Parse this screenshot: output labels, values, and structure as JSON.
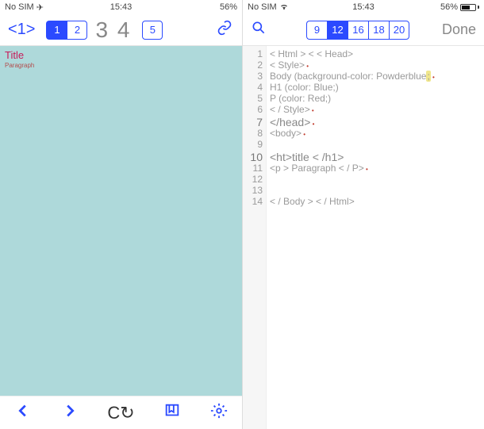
{
  "status": {
    "carrier": "No SIM",
    "time": "15:43",
    "battery_pct": "56%"
  },
  "left": {
    "toolbar": {
      "tag_label": "<1>",
      "seg": [
        "1",
        "2"
      ],
      "seg_active": 0,
      "big_digits": "3 4",
      "seg2": [
        "5"
      ]
    },
    "preview": {
      "title": "Title",
      "subtitle": "Paragraph"
    },
    "bottom_icons": [
      "back",
      "forward",
      "refresh",
      "bookmarks",
      "settings"
    ]
  },
  "right": {
    "toolbar": {
      "seg": [
        "9",
        "12",
        "16",
        "18",
        "20"
      ],
      "seg_active": 1,
      "done": "Done"
    },
    "code": [
      {
        "n": "1",
        "t": "< Html > < < Head>"
      },
      {
        "n": "2",
        "t": "< Style>",
        "dot": true
      },
      {
        "n": "3",
        "t": "Body (background-color: Powderblue;",
        "hl": true,
        "dot": true
      },
      {
        "n": "4",
        "t": "H1 (color: Blue;)"
      },
      {
        "n": "5",
        "t": "P (color: Red;)"
      },
      {
        "n": "6",
        "t": "< / Style>",
        "dot": true
      },
      {
        "n": "7",
        "t": "</head>",
        "em": true,
        "dot": true
      },
      {
        "n": "8",
        "t": "<body>",
        "dot": true
      },
      {
        "n": "9",
        "t": ""
      },
      {
        "n": "10",
        "t": "<ht>title < /h1>",
        "em": true
      },
      {
        "n": "11",
        "t": "<p > Paragraph < / P>",
        "dot": true
      },
      {
        "n": "12",
        "t": ""
      },
      {
        "n": "13",
        "t": ""
      },
      {
        "n": "14",
        "t": "< / Body > < / Html>"
      }
    ]
  }
}
